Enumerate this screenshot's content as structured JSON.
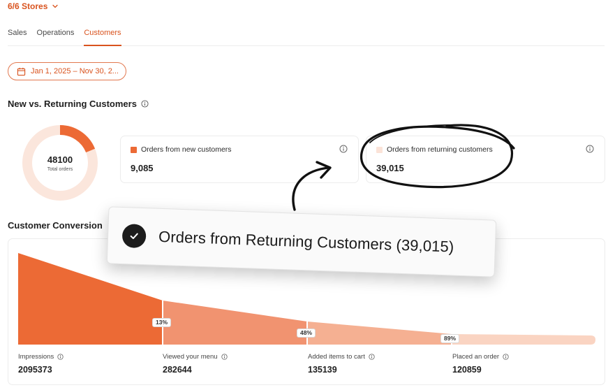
{
  "header": {
    "store_selector": "6/6 Stores"
  },
  "tabs": [
    {
      "label": "Sales",
      "active": false
    },
    {
      "label": "Operations",
      "active": false
    },
    {
      "label": "Customers",
      "active": true
    }
  ],
  "date_range": "Jan 1, 2025 – Nov 30, 2...",
  "new_vs_returning": {
    "title": "New vs. Returning Customers",
    "total_value": "48100",
    "total_label": "Total orders",
    "new_share": 0.189,
    "new_card": {
      "label": "Orders from new customers",
      "value": "9,085",
      "color": "#ec6a35"
    },
    "returning_card": {
      "label": "Orders from returning customers",
      "value": "39,015",
      "color": "#fbe3d8"
    }
  },
  "conversion": {
    "title": "Customer Conversion",
    "stages": [
      {
        "label": "Impressions",
        "value": "2095373"
      },
      {
        "label": "Viewed your menu",
        "value": "282644"
      },
      {
        "label": "Added items to cart",
        "value": "135139"
      },
      {
        "label": "Placed an order",
        "value": "120859"
      }
    ],
    "rates": [
      "13%",
      "48%",
      "89%"
    ],
    "colors": [
      "#ec6a35",
      "#f19370",
      "#f5b092",
      "#fad4c2"
    ]
  },
  "overlay_toast": {
    "text": "Orders from Returning Customers (39,015)"
  },
  "colors": {
    "accent": "#d9531e",
    "donut_track": "#fbe6dc"
  }
}
